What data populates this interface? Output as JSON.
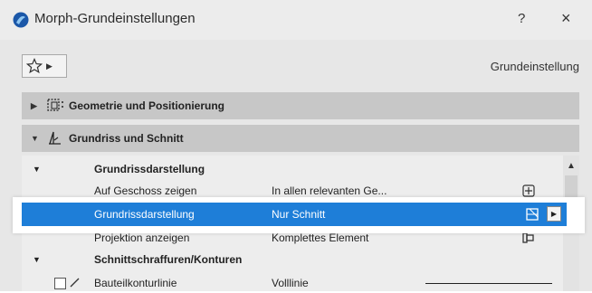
{
  "window": {
    "title": "Morph-Grundeinstellungen",
    "help_label": "?",
    "close_label": "×"
  },
  "toolbar": {
    "favorites_icon": "star-icon",
    "preset_label": "Grundeinstellung"
  },
  "panels": [
    {
      "label": "Geometrie und Positionierung",
      "expanded": false,
      "icon": "geometry-icon"
    },
    {
      "label": "Grundriss und Schnitt",
      "expanded": true,
      "icon": "floorplan-icon"
    }
  ],
  "table": {
    "groups": [
      {
        "label": "Grundrissdarstellung"
      },
      {
        "label": "Schnittschraffuren/Konturen"
      }
    ],
    "rows": [
      {
        "label": "Auf Geschoss zeigen",
        "value": "In allen relevanten Ge...",
        "icon": "stories-icon"
      },
      {
        "label": "Grundrissdarstellung",
        "value": "Nur Schnitt",
        "icon": "floorplan-display-icon",
        "selected": true
      },
      {
        "label": "Projektion anzeigen",
        "value": "Komplettes Element",
        "icon": "projection-icon"
      },
      {
        "label": "Bauteilkonturlinie",
        "value": "Volllinie",
        "icon": "line-type-icon"
      }
    ]
  },
  "colors": {
    "selection": "#1e7ed8",
    "panel_header": "#c7c7c7",
    "background": "#e7e7e7"
  }
}
